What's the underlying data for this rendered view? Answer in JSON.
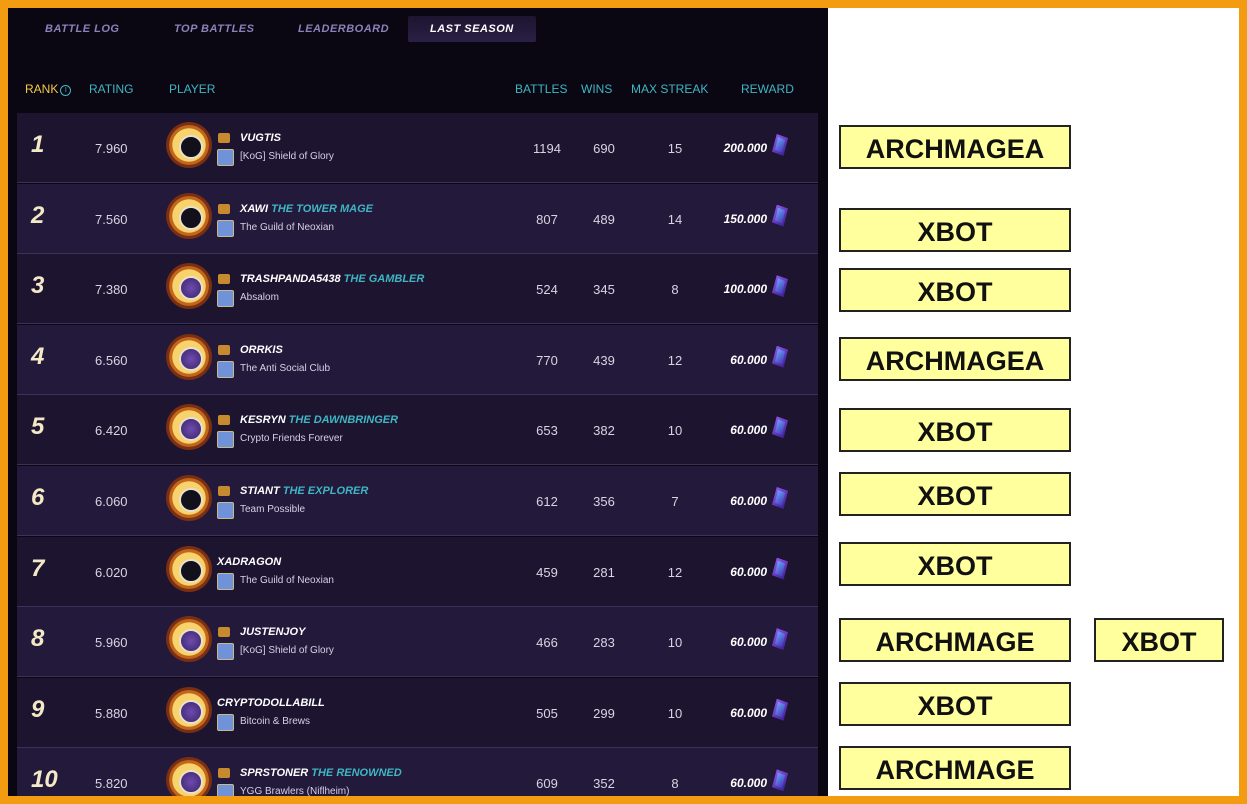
{
  "tabs": [
    {
      "label": "BATTLE LOG",
      "active": false
    },
    {
      "label": "TOP BATTLES",
      "active": false
    },
    {
      "label": "LEADERBOARD",
      "active": false
    },
    {
      "label": "LAST SEASON",
      "active": true
    }
  ],
  "columns": {
    "rank": "RANK",
    "rating": "RATING",
    "player": "PLAYER",
    "battles": "BATTLES",
    "wins": "WINS",
    "max_streak": "MAX STREAK",
    "reward": "REWARD"
  },
  "rows": [
    {
      "rank": "1",
      "rating": "7.960",
      "player": "VUGTIS",
      "title": "",
      "guild": "[KoG] Shield of Glory",
      "battles": "1194",
      "wins": "690",
      "max_streak": "15",
      "reward": "200.000"
    },
    {
      "rank": "2",
      "rating": "7.560",
      "player": "XAWI",
      "title": "THE TOWER MAGE",
      "guild": "The Guild of Neoxian",
      "battles": "807",
      "wins": "489",
      "max_streak": "14",
      "reward": "150.000"
    },
    {
      "rank": "3",
      "rating": "7.380",
      "player": "TRASHPANDA5438",
      "title": "THE GAMBLER",
      "guild": "Absalom",
      "battles": "524",
      "wins": "345",
      "max_streak": "8",
      "reward": "100.000"
    },
    {
      "rank": "4",
      "rating": "6.560",
      "player": "ORRKIS",
      "title": "",
      "guild": "The Anti Social Club",
      "battles": "770",
      "wins": "439",
      "max_streak": "12",
      "reward": "60.000"
    },
    {
      "rank": "5",
      "rating": "6.420",
      "player": "KESRYN",
      "title": "THE DAWNBRINGER",
      "guild": "Crypto Friends Forever",
      "battles": "653",
      "wins": "382",
      "max_streak": "10",
      "reward": "60.000"
    },
    {
      "rank": "6",
      "rating": "6.060",
      "player": "STIANT",
      "title": "THE EXPLORER",
      "guild": "Team Possible",
      "battles": "612",
      "wins": "356",
      "max_streak": "7",
      "reward": "60.000"
    },
    {
      "rank": "7",
      "rating": "6.020",
      "player": "XADRAGON",
      "title": "",
      "guild": "The Guild of Neoxian",
      "battles": "459",
      "wins": "281",
      "max_streak": "12",
      "reward": "60.000"
    },
    {
      "rank": "8",
      "rating": "5.960",
      "player": "JUSTENJOY",
      "title": "",
      "guild": "[KoG] Shield of Glory",
      "battles": "466",
      "wins": "283",
      "max_streak": "10",
      "reward": "60.000"
    },
    {
      "rank": "9",
      "rating": "5.880",
      "player": "CRYPTODOLLABILL",
      "title": "",
      "guild": "Bitcoin & Brews",
      "battles": "505",
      "wins": "299",
      "max_streak": "10",
      "reward": "60.000"
    },
    {
      "rank": "10",
      "rating": "5.820",
      "player": "SPRSTONER",
      "title": "THE RENOWNED",
      "guild": "YGG Brawlers (Niflheim)",
      "battles": "609",
      "wins": "352",
      "max_streak": "8",
      "reward": "60.000"
    }
  ],
  "annotations": [
    {
      "text": "ARCHMAGEA"
    },
    {
      "text": "XBOT"
    },
    {
      "text": "XBOT"
    },
    {
      "text": "ARCHMAGEA"
    },
    {
      "text": "XBOT"
    },
    {
      "text": "XBOT"
    },
    {
      "text": "XBOT"
    },
    {
      "text": "ARCHMAGE"
    },
    {
      "text": "XBOT"
    },
    {
      "text": "XBOT"
    },
    {
      "text": "ARCHMAGE"
    }
  ],
  "colors": {
    "border": "#f39c12",
    "game_bg": "#0b0712",
    "header_text": "#3eb6c4",
    "rank_header": "#f2c94c",
    "annotation_bg": "#ffff9d"
  }
}
